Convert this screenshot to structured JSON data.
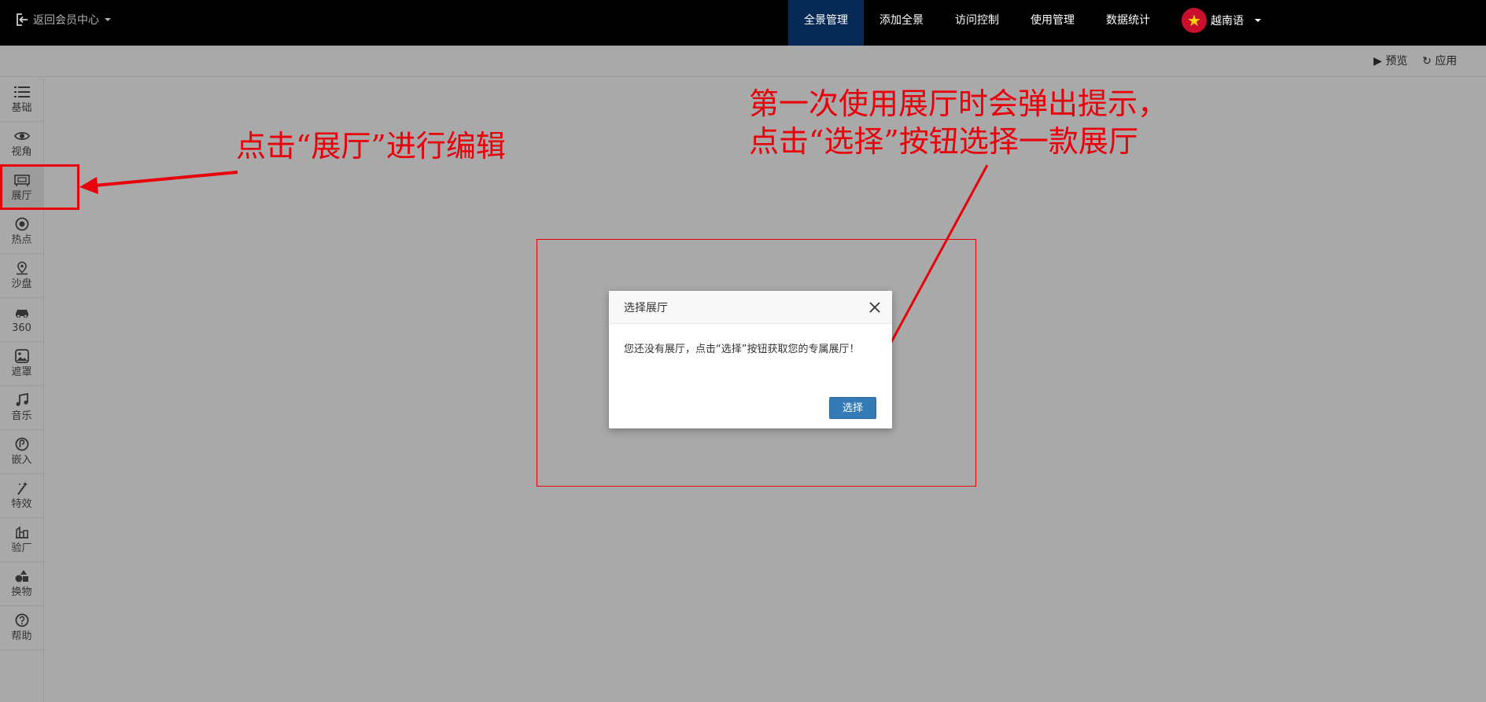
{
  "topbar": {
    "back_label": "返回会员中心",
    "nav": [
      "全景管理",
      "添加全景",
      "访问控制",
      "使用管理",
      "数据统计"
    ],
    "active_nav": "全景管理",
    "language": "越南语"
  },
  "toolbar": {
    "preview_label": "▶ 预览",
    "apply_label": "应用"
  },
  "sidebar": {
    "items": [
      {
        "label": "基础",
        "icon": "list-icon"
      },
      {
        "label": "视角",
        "icon": "eye-icon"
      },
      {
        "label": "展厅",
        "icon": "gallery-icon"
      },
      {
        "label": "热点",
        "icon": "target-icon"
      },
      {
        "label": "沙盘",
        "icon": "map-pin-icon"
      },
      {
        "label": "360",
        "icon": "car-icon"
      },
      {
        "label": "遮罩",
        "icon": "image-icon"
      },
      {
        "label": "音乐",
        "icon": "music-icon"
      },
      {
        "label": "嵌入",
        "icon": "embed-icon"
      },
      {
        "label": "特效",
        "icon": "magic-wand-icon"
      },
      {
        "label": "验厂",
        "icon": "factory-icon"
      },
      {
        "label": "换物",
        "icon": "objects-icon"
      },
      {
        "label": "帮助",
        "icon": "help-icon"
      }
    ],
    "active_item": "展厅"
  },
  "annotations": {
    "left_note": "点击“展厅”进行编辑",
    "right_note_line1": "第一次使用展厅时会弹出提示，",
    "right_note_line2": "点击“选择”按钮选择一款展厅",
    "color": "#e8000b"
  },
  "modal": {
    "title": "选择展厅",
    "body": "您还没有展厅，点击“选择”按钮获取您的专属展厅！",
    "button_label": "选择",
    "button_color": "#337ab7"
  },
  "colors": {
    "topbar_bg": "#000000",
    "active_nav_bg": "#062a55",
    "page_bg": "#a9a9a9"
  }
}
